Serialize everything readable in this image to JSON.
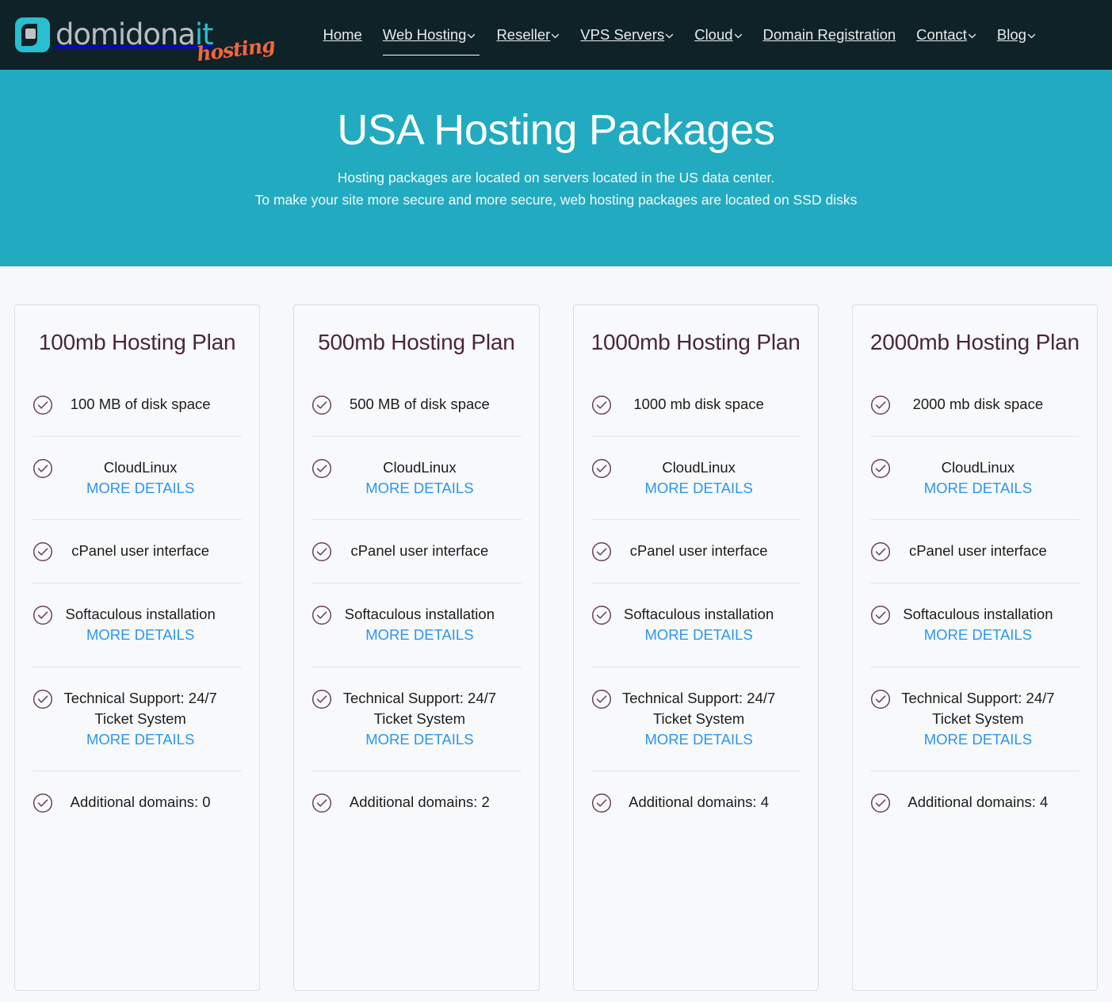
{
  "brand": {
    "logo_icon": "rounded-square-logo-icon",
    "text_main": "domidona",
    "text_accent": "it",
    "tagline": "hosting",
    "color_accent": "#28bfd0",
    "color_tagline": "#f4663c",
    "color_text_main": "#b9bdc1"
  },
  "header": {
    "background": "#0e2227",
    "nav": [
      {
        "label": "Home",
        "has_caret": false,
        "active": false
      },
      {
        "label": "Web Hosting",
        "has_caret": true,
        "active": true
      },
      {
        "label": "Reseller",
        "has_caret": true,
        "active": false
      },
      {
        "label": "VPS Servers",
        "has_caret": true,
        "active": false
      },
      {
        "label": "Cloud",
        "has_caret": true,
        "active": false
      },
      {
        "label": "Domain Registration",
        "has_caret": false,
        "active": false
      },
      {
        "label": "Contact",
        "has_caret": true,
        "active": false
      },
      {
        "label": "Blog",
        "has_caret": true,
        "active": false
      }
    ]
  },
  "hero": {
    "background": "#22abc0",
    "title": "USA Hosting Packages",
    "subtitle_line1": "Hosting packages are located on servers located in the US data center.",
    "subtitle_line2": "To make your site more secure and more secure, web hosting packages are located on SSD disks"
  },
  "theme": {
    "page_background": "#f7f8fa",
    "card_background": "#f8f9fb",
    "card_border": "#dcdee2",
    "plan_title_color": "#4a2639",
    "check_icon_color": "#6b4355",
    "link_color": "#2b96f0",
    "divider_color": "#e2e4e8"
  },
  "more_details_label": "MORE DETAILS",
  "plans": [
    {
      "title": "100mb Hosting Plan",
      "features": [
        {
          "text": "100 MB of disk space",
          "link": null
        },
        {
          "text": "CloudLinux",
          "link": "MORE DETAILS"
        },
        {
          "text": "cPanel user interface",
          "link": null
        },
        {
          "text": "Softaculous installation",
          "link": "MORE DETAILS"
        },
        {
          "text": "Technical Support: 24/7 Ticket System",
          "link": "MORE DETAILS"
        },
        {
          "text": "Additional domains: 0",
          "link": null
        }
      ]
    },
    {
      "title": "500mb Hosting Plan",
      "features": [
        {
          "text": "500 MB of disk space",
          "link": null
        },
        {
          "text": "CloudLinux",
          "link": "MORE DETAILS"
        },
        {
          "text": "cPanel user interface",
          "link": null
        },
        {
          "text": "Softaculous installation",
          "link": "MORE DETAILS"
        },
        {
          "text": "Technical Support: 24/7 Ticket System",
          "link": "MORE DETAILS"
        },
        {
          "text": "Additional domains: 2",
          "link": null
        }
      ]
    },
    {
      "title": "1000mb Hosting Plan",
      "features": [
        {
          "text": "1000 mb disk space",
          "link": null
        },
        {
          "text": "CloudLinux",
          "link": "MORE DETAILS"
        },
        {
          "text": "cPanel user interface",
          "link": null
        },
        {
          "text": "Softaculous installation",
          "link": "MORE DETAILS"
        },
        {
          "text": "Technical Support: 24/7 Ticket System",
          "link": "MORE DETAILS"
        },
        {
          "text": "Additional domains: 4",
          "link": null
        }
      ]
    },
    {
      "title": "2000mb Hosting Plan",
      "features": [
        {
          "text": "2000 mb disk space",
          "link": null
        },
        {
          "text": "CloudLinux",
          "link": "MORE DETAILS"
        },
        {
          "text": "cPanel user interface",
          "link": null
        },
        {
          "text": "Softaculous installation",
          "link": "MORE DETAILS"
        },
        {
          "text": "Technical Support: 24/7 Ticket System",
          "link": "MORE DETAILS"
        },
        {
          "text": "Additional domains: 4",
          "link": null
        }
      ]
    }
  ]
}
